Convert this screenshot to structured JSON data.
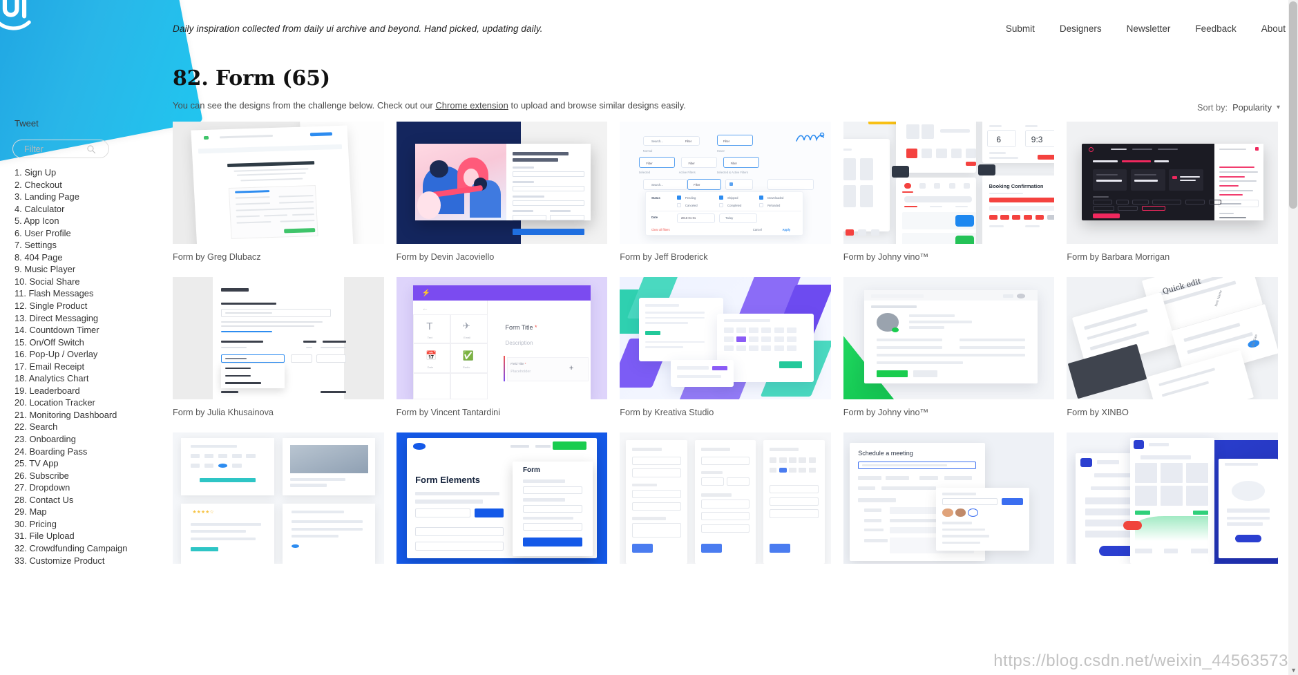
{
  "header": {
    "tagline": "Daily inspiration collected from daily ui archive and beyond. Hand picked, updating daily.",
    "nav": [
      {
        "label": "Submit"
      },
      {
        "label": "Designers"
      },
      {
        "label": "Newsletter"
      },
      {
        "label": "Feedback"
      },
      {
        "label": "About"
      }
    ]
  },
  "sidebar": {
    "tweet_label": "Tweet",
    "filter_placeholder": "Filter",
    "filter_value": "",
    "search_icon": "search-icon",
    "items": [
      "1. Sign Up",
      "2. Checkout",
      "3. Landing Page",
      "4. Calculator",
      "5. App Icon",
      "6. User Profile",
      "7. Settings",
      "8. 404 Page",
      "9. Music Player",
      "10. Social Share",
      "11. Flash Messages",
      "12. Single Product",
      "13. Direct Messaging",
      "14. Countdown Timer",
      "15. On/Off Switch",
      "16. Pop-Up / Overlay",
      "17. Email Receipt",
      "18. Analytics Chart",
      "19. Leaderboard",
      "20. Location Tracker",
      "21. Monitoring Dashboard",
      "22. Search",
      "23. Onboarding",
      "24. Boarding Pass",
      "25. TV App",
      "26. Subscribe",
      "27. Dropdown",
      "28. Contact Us",
      "29. Map",
      "30. Pricing",
      "31. File Upload",
      "32. Crowdfunding Campaign",
      "33. Customize Product"
    ]
  },
  "main": {
    "title": "82. Form (65)",
    "subtitle_before": "You can see the designs from the challenge below. Check out our ",
    "subtitle_link": "Chrome extension",
    "subtitle_after": " to upload and browse similar designs easily.",
    "sort_label": "Sort by:",
    "sort_value": "Popularity",
    "sort_caret": "chevron-down-icon"
  },
  "cards": [
    {
      "caption": "Form by Greg Dlubacz",
      "thumb": "dealer-information-sheet"
    },
    {
      "caption": "Form by Devin Jacoviello",
      "thumb": "definitive-guide-marketing"
    },
    {
      "caption": "Form by Jeff Broderick",
      "thumb": "filter-components"
    },
    {
      "caption": "Form by Johny vino™",
      "thumb": "booking-confirmation"
    },
    {
      "caption": "Form by Barbara Morrigan",
      "thumb": "dark-brief-form"
    },
    {
      "caption": "Form by Julia Khusainova",
      "thumb": "shyp-shipping-form"
    },
    {
      "caption": "Form by Vincent Tantardini",
      "thumb": "form-builder-purple"
    },
    {
      "caption": "Form by Kreativa Studio",
      "thumb": "geometric-dashboard"
    },
    {
      "caption": "Form by Johny vino™",
      "thumb": "edit-profile-green"
    },
    {
      "caption": "Form by XINBO",
      "thumb": "quick-edit-isometric"
    },
    {
      "caption": "",
      "thumb": "calendar-application"
    },
    {
      "caption": "",
      "thumb": "form-elements-blue"
    },
    {
      "caption": "",
      "thumb": "three-column-forms"
    },
    {
      "caption": "",
      "thumb": "schedule-a-meeting"
    },
    {
      "caption": "",
      "thumb": "wealth-app-blue"
    }
  ],
  "watermark": "https://blog.csdn.net/weixin_44563573",
  "colors": {
    "brand_blue": "#1b9de0",
    "brand_cyan": "#21c5ef",
    "link": "#2d8cf0",
    "text": "#333333"
  }
}
